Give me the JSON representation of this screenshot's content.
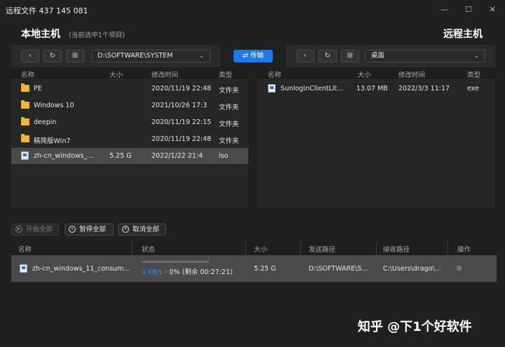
{
  "window": {
    "title": "远程文件 437 145 081"
  },
  "local": {
    "title": "本地主机",
    "subtitle": "(当前选中1个项目)",
    "path": "D:\\SOFTWARE\\SYSTEM",
    "columns": [
      "名称",
      "大小",
      "修改时间",
      "类型"
    ],
    "rows": [
      {
        "name": "PE",
        "size": "",
        "modified": "2020/11/19 22:48",
        "type": "文件夹",
        "icon": "folder-icon"
      },
      {
        "name": "Windows 10",
        "size": "",
        "modified": "2021/10/26 17:3",
        "type": "文件夹",
        "icon": "folder-icon"
      },
      {
        "name": "deepin",
        "size": "",
        "modified": "2020/11/19 22:15",
        "type": "文件夹",
        "icon": "folder-icon"
      },
      {
        "name": "精简版Win7",
        "size": "",
        "modified": "2020/11/19 22:48",
        "type": "文件夹",
        "icon": "folder-icon"
      },
      {
        "name": "zh-cn_windows_...",
        "size": "5.25 G",
        "modified": "2022/1/22 21:4",
        "type": "iso",
        "icon": "iso-file-icon",
        "selected": true
      }
    ]
  },
  "transfer_label": "传输",
  "remote": {
    "title": "远程主机",
    "path": "桌面",
    "columns": [
      "名称",
      "大小",
      "修改时间",
      "类型"
    ],
    "rows": [
      {
        "name": "SunloginClientLit...",
        "size": "13.07 MB",
        "modified": "2022/3/3 11:17",
        "type": "exe",
        "icon": "exe-file-icon"
      }
    ]
  },
  "actions": {
    "start_all": "开始全部",
    "pause_all": "暂停全部",
    "cancel_all": "取消全部"
  },
  "queue": {
    "columns": [
      "名称",
      "状态",
      "大小",
      "发送路径",
      "接收路径",
      "操作"
    ],
    "rows": [
      {
        "name": "zh-cn_windows_11_consum...",
        "speed": "0 KB/s",
        "status": " - 0% (剩余 00:27:21)",
        "progress": 0.02,
        "size": "5.25 G",
        "send_path": "D:\\SOFTWARE\\S...",
        "recv_path": "C:\\Users\\drago\\..."
      }
    ]
  },
  "watermark": "知乎 @下1个好软件",
  "colors": {
    "accent": "#1e7be6",
    "folder": "#f0b43a",
    "selected_row": "#4a4a4a"
  }
}
